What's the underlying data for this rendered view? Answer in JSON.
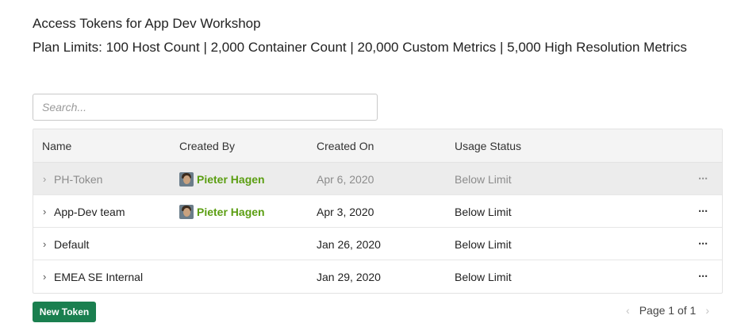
{
  "header": {
    "title": "Access Tokens for App Dev Workshop",
    "plan_limits": "Plan Limits: 100 Host Count | 2,000 Container Count | 20,000 Custom Metrics | 5,000 High Resolution Metrics"
  },
  "search": {
    "placeholder": "Search...",
    "value": ""
  },
  "table": {
    "columns": [
      "Name",
      "Created By",
      "Created On",
      "Usage Status"
    ],
    "rows": [
      {
        "name": "PH-Token",
        "created_by": "Pieter Hagen",
        "created_on": "Apr 6, 2020",
        "usage_status": "Below Limit"
      },
      {
        "name": "App-Dev team",
        "created_by": "Pieter Hagen",
        "created_on": "Apr 3, 2020",
        "usage_status": "Below Limit"
      },
      {
        "name": "Default",
        "created_by": "",
        "created_on": "Jan 26, 2020",
        "usage_status": "Below Limit"
      },
      {
        "name": "EMEA SE Internal",
        "created_by": "",
        "created_on": "Jan 29, 2020",
        "usage_status": "Below Limit"
      }
    ],
    "more_glyph": "···",
    "expand_glyph": "›"
  },
  "actions": {
    "new_token_label": "New Token"
  },
  "pagination": {
    "label": "Page 1 of 1",
    "prev_glyph": "‹",
    "next_glyph": "›"
  },
  "colors": {
    "accent_green": "#1a7f4f",
    "user_link": "#5b9e12",
    "highlight_row": "#ececec"
  }
}
